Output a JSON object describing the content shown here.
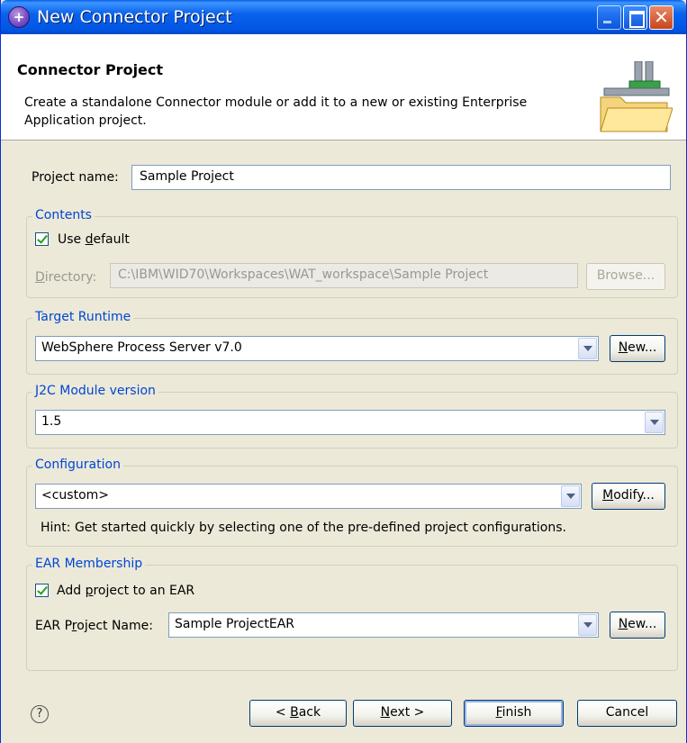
{
  "window": {
    "title": "New Connector Project"
  },
  "header": {
    "title": "Connector Project",
    "description": "Create a standalone Connector module or add it to a new or existing Enterprise Application project."
  },
  "project_name": {
    "label": "Project name:",
    "value": "Sample Project"
  },
  "contents": {
    "legend": "Contents",
    "use_default": {
      "label": "Use default",
      "checked": true
    },
    "directory": {
      "label": "Directory:",
      "value": "C:\\IBM\\WID70\\Workspaces\\WAT_workspace\\Sample Project"
    },
    "browse_label": "Browse..."
  },
  "target_runtime": {
    "legend": "Target Runtime",
    "value": "WebSphere Process Server v7.0",
    "new_label": "New..."
  },
  "j2c_version": {
    "legend": "J2C Module version",
    "value": "1.5"
  },
  "configuration": {
    "legend": "Configuration",
    "value": "<custom>",
    "modify_label": "Modify...",
    "hint": "Hint: Get started quickly by selecting one of the pre-defined project configurations."
  },
  "ear": {
    "legend": "EAR Membership",
    "add_to_ear": {
      "label": "Add project to an EAR",
      "checked": true
    },
    "project_label": "EAR Project Name:",
    "project_value": "Sample ProjectEAR",
    "new_label": "New..."
  },
  "footer": {
    "help": "?",
    "back_label": "< Back",
    "next_label": "Next >",
    "finish_label": "Finish",
    "cancel_label": "Cancel"
  }
}
